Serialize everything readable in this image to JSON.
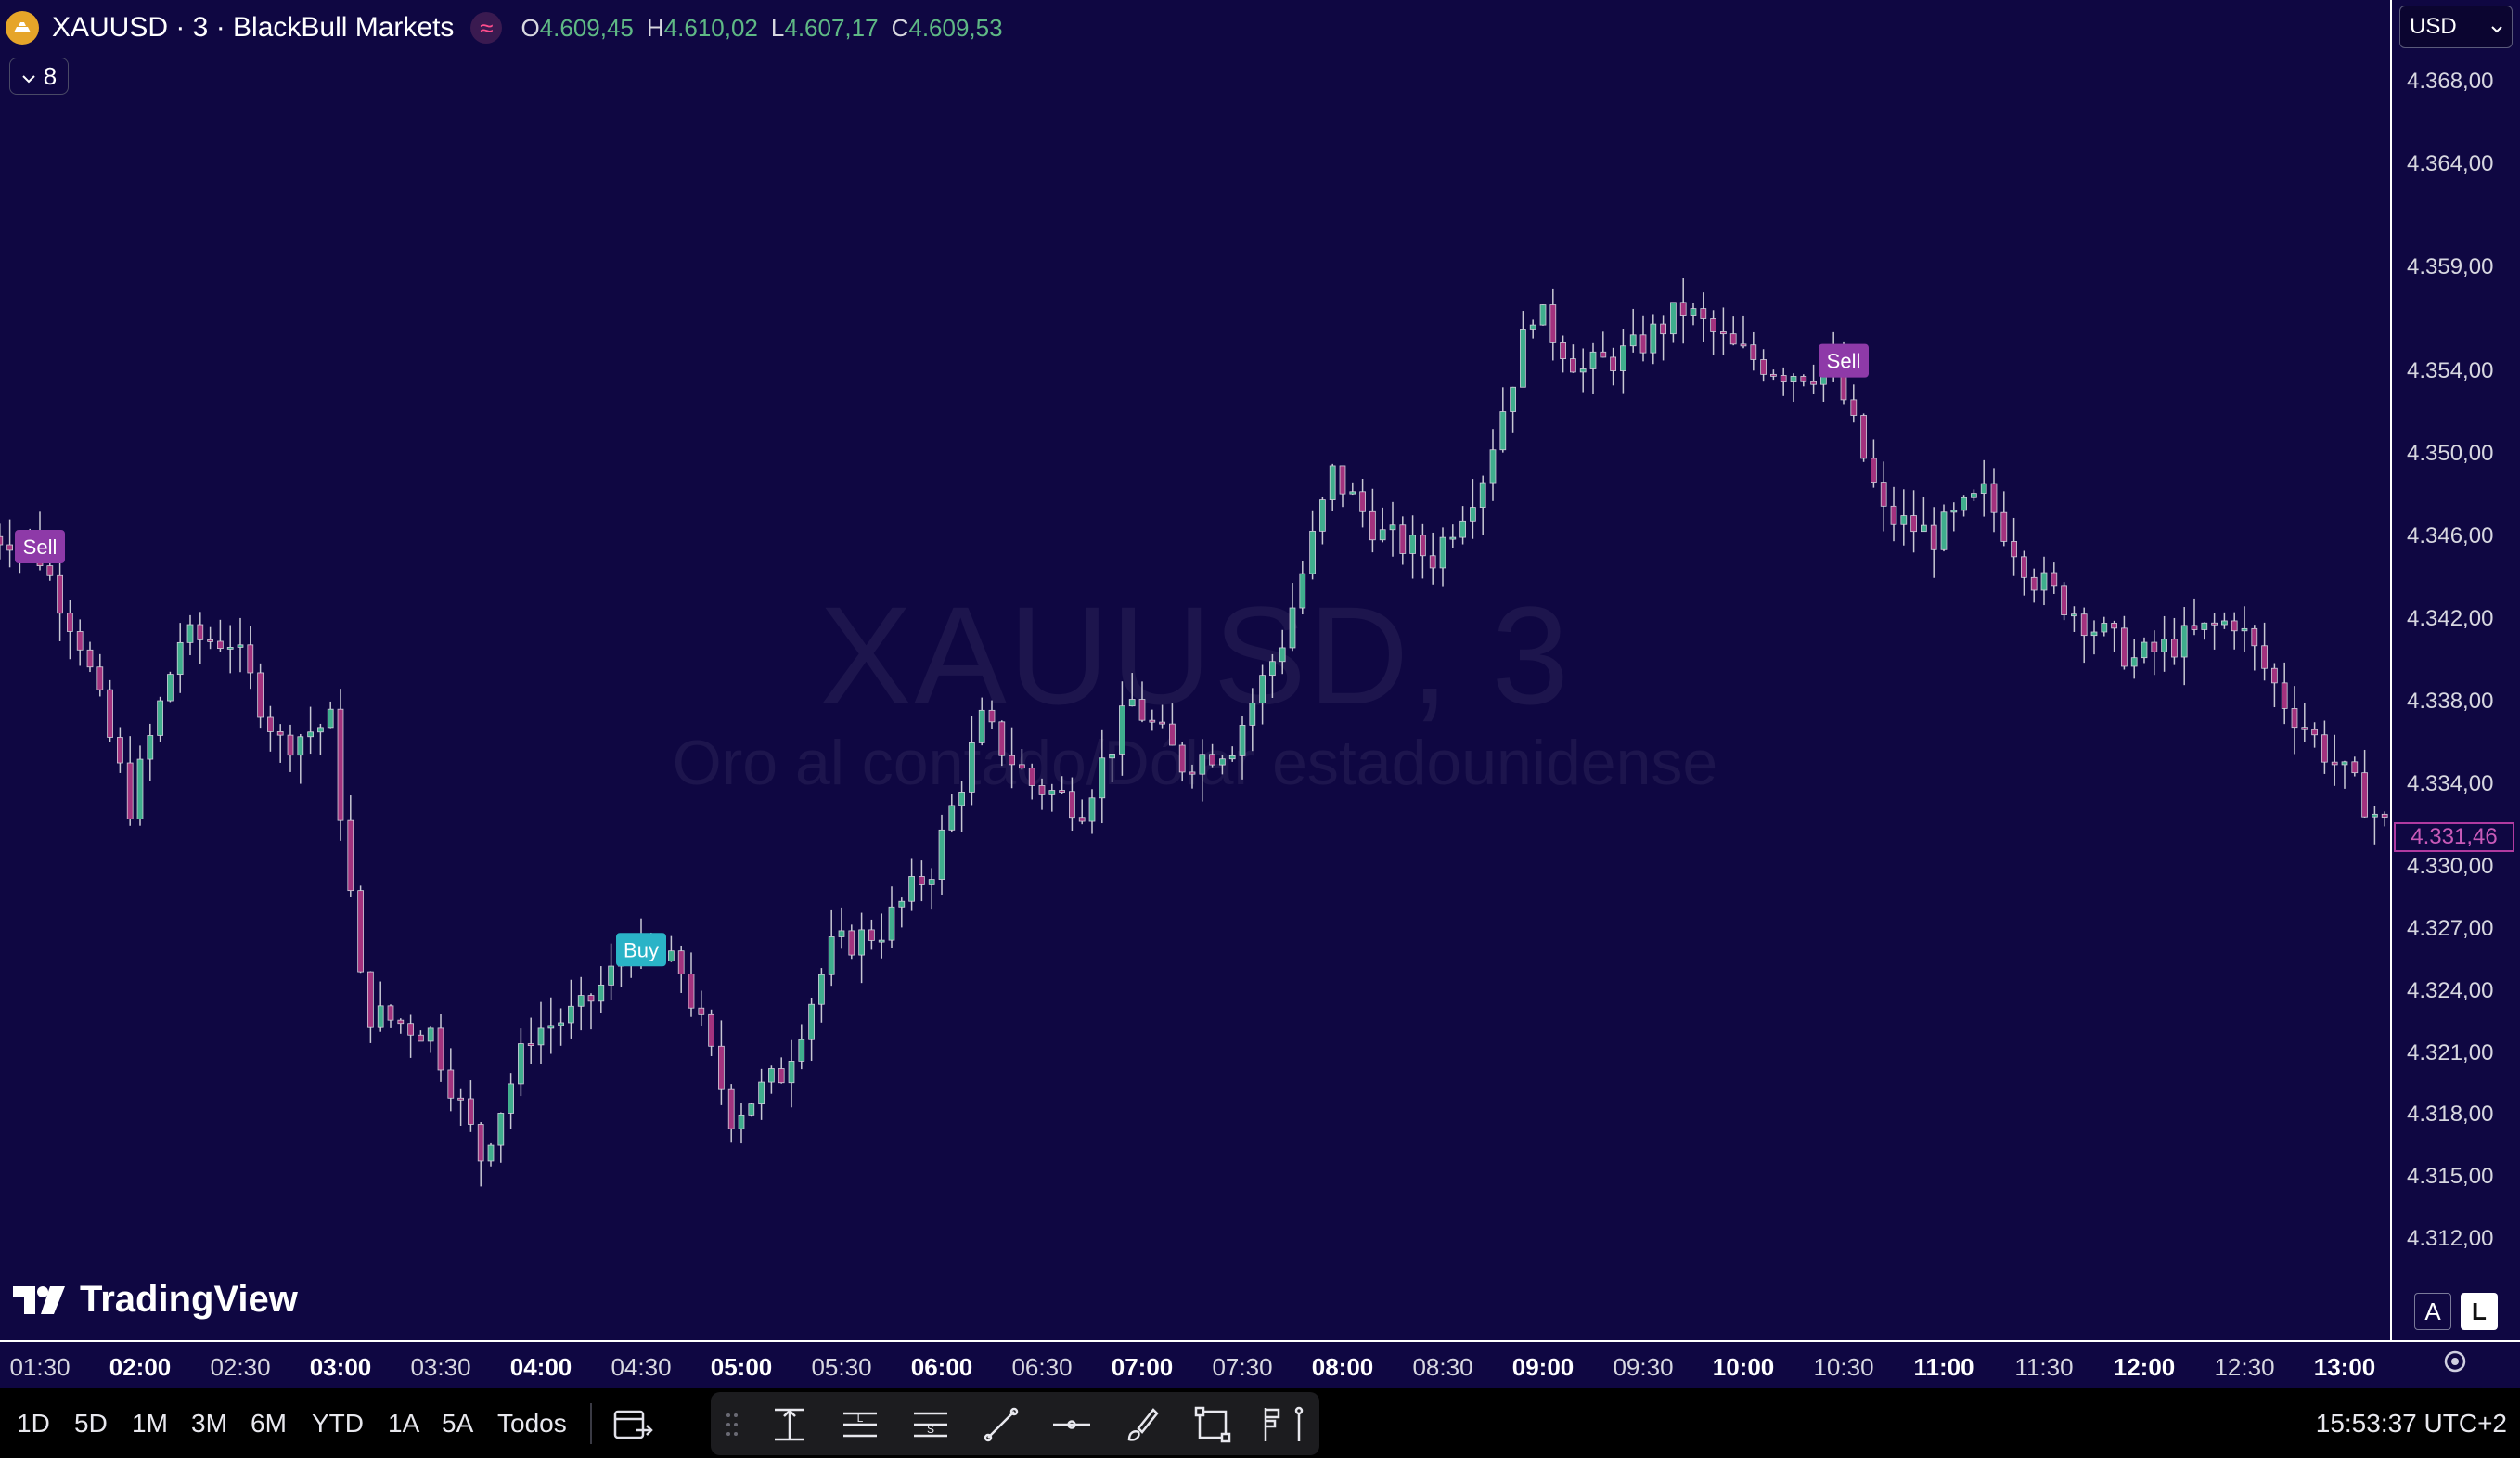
{
  "header": {
    "symbol_title": "XAUUSD · 3 · BlackBull Markets",
    "interval_icon": "≈",
    "ohlc": {
      "o_label": "O",
      "o_value": "4.609,45",
      "h_label": "H",
      "h_value": "4.610,02",
      "l_label": "L",
      "l_value": "4.607,17",
      "c_label": "C",
      "c_value": "4.609,53"
    },
    "indicators_count": "8"
  },
  "watermark": {
    "title": "XAUUSD, 3",
    "subtitle": "Oro al contado/Dólar estadounidense"
  },
  "brand": "TradingView",
  "currency": "USD",
  "price_axis": {
    "labels": [
      "4.368,00",
      "4.364,00",
      "4.359,00",
      "4.354,00",
      "4.350,00",
      "4.346,00",
      "4.342,00",
      "4.338,00",
      "4.334,00",
      "4.330,00",
      "4.327,00",
      "4.324,00",
      "4.321,00",
      "4.318,00",
      "4.315,00",
      "4.312,00"
    ],
    "last_price": "4.331,46",
    "auto_label": "A",
    "log_label": "L"
  },
  "time_axis": {
    "labels": [
      {
        "t": "01:30",
        "major": false
      },
      {
        "t": "02:00",
        "major": true
      },
      {
        "t": "02:30",
        "major": false
      },
      {
        "t": "03:00",
        "major": true
      },
      {
        "t": "03:30",
        "major": false
      },
      {
        "t": "04:00",
        "major": true
      },
      {
        "t": "04:30",
        "major": false
      },
      {
        "t": "05:00",
        "major": true
      },
      {
        "t": "05:30",
        "major": false
      },
      {
        "t": "06:00",
        "major": true
      },
      {
        "t": "06:30",
        "major": false
      },
      {
        "t": "07:00",
        "major": true
      },
      {
        "t": "07:30",
        "major": false
      },
      {
        "t": "08:00",
        "major": true
      },
      {
        "t": "08:30",
        "major": false
      },
      {
        "t": "09:00",
        "major": true
      },
      {
        "t": "09:30",
        "major": false
      },
      {
        "t": "10:00",
        "major": true
      },
      {
        "t": "10:30",
        "major": false
      },
      {
        "t": "11:00",
        "major": true
      },
      {
        "t": "11:30",
        "major": false
      },
      {
        "t": "12:00",
        "major": true
      },
      {
        "t": "12:30",
        "major": false
      },
      {
        "t": "13:00",
        "major": true
      }
    ]
  },
  "signals": [
    {
      "label": "Sell",
      "type": "sell",
      "time": "01:30",
      "price": 4345.5
    },
    {
      "label": "Buy",
      "type": "buy",
      "time": "04:30",
      "price": 4326.0
    },
    {
      "label": "Sell",
      "type": "sell",
      "time": "10:30",
      "price": 4354.5
    }
  ],
  "bottom_bar": {
    "ranges": [
      "1D",
      "5D",
      "1M",
      "3M",
      "6M",
      "YTD",
      "1A",
      "5A",
      "Todos"
    ],
    "clock": "15:53:37 UTC+2"
  },
  "colors": {
    "background": "#0f0742",
    "up": "#3fae8d",
    "down": "#a3327e",
    "sell_marker": "#8e3aa8",
    "buy_marker": "#2ab3c7"
  },
  "chart_data": {
    "type": "candlestick",
    "symbol": "XAUUSD",
    "interval": "3",
    "ylim": [
      4310,
      4370
    ],
    "time_range": [
      "01:15",
      "13:45"
    ],
    "close_path": [
      [
        "01:15",
        4346
      ],
      [
        "01:30",
        4346
      ],
      [
        "01:45",
        4341
      ],
      [
        "02:00",
        4333
      ],
      [
        "02:15",
        4341
      ],
      [
        "02:30",
        4341
      ],
      [
        "02:45",
        4336
      ],
      [
        "03:00",
        4337
      ],
      [
        "03:10",
        4323
      ],
      [
        "03:30",
        4322
      ],
      [
        "03:45",
        4316
      ],
      [
        "04:00",
        4322
      ],
      [
        "04:15",
        4323
      ],
      [
        "04:30",
        4326
      ],
      [
        "04:45",
        4325
      ],
      [
        "05:00",
        4318
      ],
      [
        "05:15",
        4320
      ],
      [
        "05:30",
        4326
      ],
      [
        "05:45",
        4327
      ],
      [
        "06:00",
        4330
      ],
      [
        "06:15",
        4337
      ],
      [
        "06:30",
        4334
      ],
      [
        "06:45",
        4333
      ],
      [
        "07:00",
        4338
      ],
      [
        "07:15",
        4335
      ],
      [
        "07:30",
        4336
      ],
      [
        "07:45",
        4341
      ],
      [
        "08:00",
        4349
      ],
      [
        "08:15",
        4346
      ],
      [
        "08:30",
        4345
      ],
      [
        "08:45",
        4349
      ],
      [
        "09:00",
        4357
      ],
      [
        "09:15",
        4354
      ],
      [
        "09:30",
        4355
      ],
      [
        "09:45",
        4357
      ],
      [
        "10:00",
        4355
      ],
      [
        "10:15",
        4354
      ],
      [
        "10:30",
        4354
      ],
      [
        "10:45",
        4347
      ],
      [
        "11:00",
        4346
      ],
      [
        "11:15",
        4348
      ],
      [
        "11:30",
        4344
      ],
      [
        "11:45",
        4342
      ],
      [
        "12:00",
        4340
      ],
      [
        "12:15",
        4341
      ],
      [
        "12:30",
        4342
      ],
      [
        "12:45",
        4338
      ],
      [
        "13:00",
        4335
      ],
      [
        "13:15",
        4332
      ],
      [
        "13:45",
        4331.46
      ]
    ]
  }
}
